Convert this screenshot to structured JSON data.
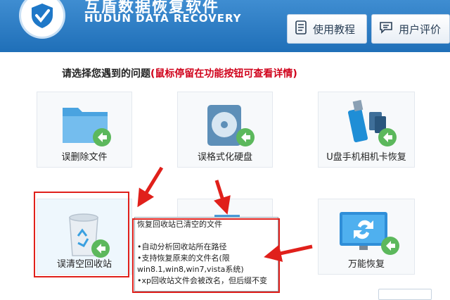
{
  "header": {
    "title": "互盾数据恢复软件",
    "subtitle": "HUDUN DATA RECOVERY",
    "buttons": [
      {
        "label": "使用教程",
        "icon": "document-icon"
      },
      {
        "label": "用户评价",
        "icon": "chat-icon"
      }
    ]
  },
  "prompt": {
    "text": "请选择您遇到的问题",
    "hint": "(鼠标停留在功能按钮可查看详情)"
  },
  "tiles": [
    {
      "label": "误删除文件",
      "icon": "folder-icon"
    },
    {
      "label": "误格式化硬盘",
      "icon": "hard-disk-icon"
    },
    {
      "label": "U盘手机相机卡恢复",
      "icon": "usb-drive-icon"
    },
    {
      "label": "误清空回收站",
      "icon": "recycle-bin-icon"
    },
    {
      "label": "",
      "icon": "partition-icon"
    },
    {
      "label": "万能恢复",
      "icon": "monitor-refresh-icon"
    }
  ],
  "tooltip": {
    "lines": [
      "恢复回收站已清空的文件",
      "",
      "•自动分析回收站所在路径",
      "•支持恢复原来的文件名(限",
      "win8.1,win8,win7,vista系统)",
      "•xp回收站文件会被改名，但后缀不变"
    ]
  },
  "colors": {
    "header": "#2a7cc7",
    "annotation_red": "#e0201b",
    "hint_red": "#d0021b"
  }
}
